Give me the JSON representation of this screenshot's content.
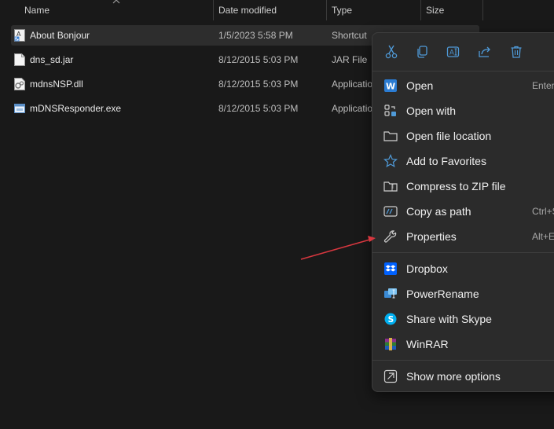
{
  "columns": {
    "name": "Name",
    "date_modified": "Date modified",
    "type": "Type",
    "size": "Size"
  },
  "files": [
    {
      "name": "About Bonjour",
      "date": "1/5/2023 5:58 PM",
      "type": "Shortcut",
      "icon": "shortcut-file-icon"
    },
    {
      "name": "dns_sd.jar",
      "date": "8/12/2015 5:03 PM",
      "type": "JAR File",
      "icon": "jar-file-icon"
    },
    {
      "name": "mdnsNSP.dll",
      "date": "8/12/2015 5:03 PM",
      "type": "Application",
      "icon": "dll-file-icon"
    },
    {
      "name": "mDNSResponder.exe",
      "date": "8/12/2015 5:03 PM",
      "type": "Application",
      "icon": "exe-file-icon"
    }
  ],
  "context_menu": {
    "quick_actions": [
      "cut-icon",
      "copy-icon",
      "rename-icon",
      "share-icon",
      "delete-icon"
    ],
    "items": [
      {
        "label": "Open",
        "shortcut": "Enter",
        "icon": "word-icon"
      },
      {
        "label": "Open with",
        "shortcut": "",
        "icon": "open-with-icon"
      },
      {
        "label": "Open file location",
        "shortcut": "",
        "icon": "folder-icon"
      },
      {
        "label": "Add to Favorites",
        "shortcut": "",
        "icon": "star-icon"
      },
      {
        "label": "Compress to ZIP file",
        "shortcut": "",
        "icon": "zip-folder-icon"
      },
      {
        "label": "Copy as path",
        "shortcut": "Ctrl+S",
        "icon": "path-icon"
      },
      {
        "label": "Properties",
        "shortcut": "Alt+E",
        "icon": "wrench-icon"
      }
    ],
    "app_items": [
      {
        "label": "Dropbox",
        "icon": "dropbox-icon"
      },
      {
        "label": "PowerRename",
        "icon": "powerrename-icon"
      },
      {
        "label": "Share with Skype",
        "icon": "skype-icon"
      },
      {
        "label": "WinRAR",
        "icon": "winrar-icon"
      }
    ],
    "more": {
      "label": "Show more options",
      "icon": "show-more-icon"
    }
  },
  "colors": {
    "background": "#191919",
    "menu_background": "#2b2b2b",
    "accent": "#4f9ad8",
    "annotation_arrow": "#d7373f"
  }
}
